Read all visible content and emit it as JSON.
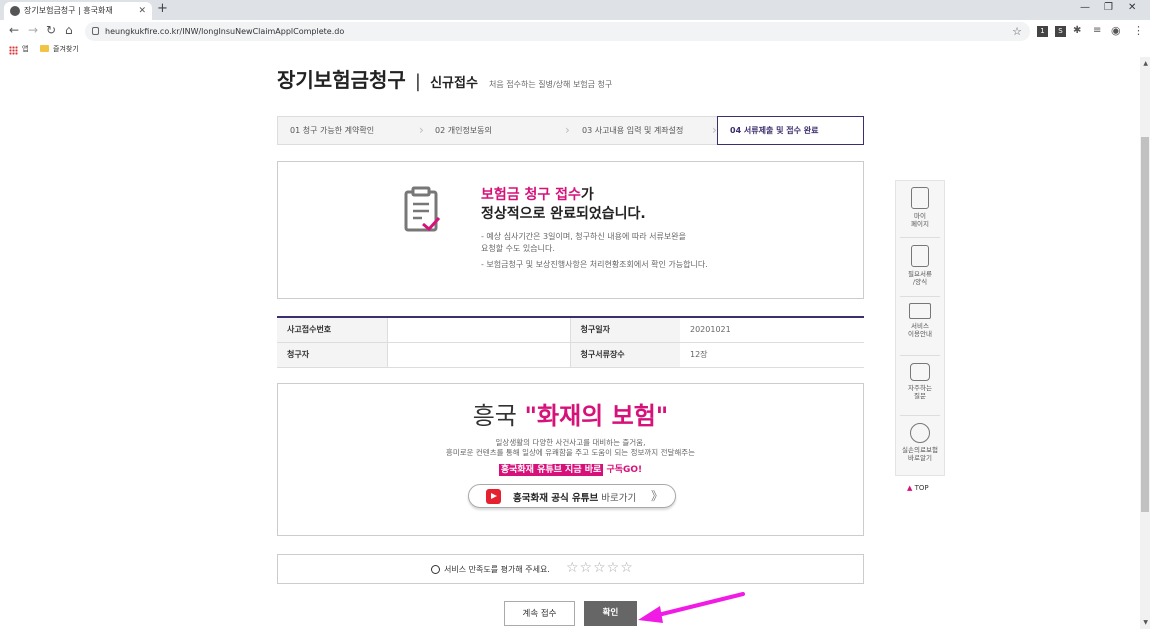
{
  "browser": {
    "tab_title": "장기보험금청구 | 흥국화재",
    "url": "heungkukfire.co.kr/INW/longInsuNewClaimApplComplete.do",
    "bookmarks": [
      "앱",
      "즐겨찾기"
    ],
    "extensions": [
      "1",
      "S"
    ]
  },
  "header": {
    "title": "장기보험금청구",
    "separator": "|",
    "subtitle": "신규접수",
    "description": "처음 접수하는 질병/상해 보험금 청구"
  },
  "steps": [
    {
      "label": "01 청구 가능한 계약확인",
      "active": false
    },
    {
      "label": "02  개인정보동의",
      "active": false
    },
    {
      "label": "03  사고내용 입력 및 계좌설정",
      "active": false
    },
    {
      "label": "04  서류제출 및 접수 완료",
      "active": true
    }
  ],
  "completion": {
    "highlight": "보험금 청구 접수",
    "head_suffix": "가",
    "head_line2": "정상적으로 완료되었습니다.",
    "notes": [
      "-  예상 심사기간은 3일이며, 청구하신 내용에 따라 서류보완을",
      "    요청할 수도 있습니다.",
      "-  보험금청구 및 보상진행사항은 처리현황조회에서 확인 가능합니다."
    ]
  },
  "info_table": {
    "rows": [
      {
        "label1": "사고접수번호",
        "value1": "",
        "label2": "청구일자",
        "value2": "20201021"
      },
      {
        "label1": "청구자",
        "value1": "",
        "label2": "청구서류장수",
        "value2": "12장"
      }
    ]
  },
  "promo": {
    "title_prefix": "흥국 ",
    "title_highlight": "\"화재의 보험\"",
    "line1": "일상생활의 다양한 사건사고를 대비하는 즐거움,",
    "line2": "흥미로운 컨텐츠를 통해 일상에 유쾌함을 주고 도움이 되는 정보까지 전달해주는",
    "cta_highlight": "흥국화재 유튜브 지금 바로",
    "cta_suffix": " 구독GO!",
    "youtube_label": "흥국화재 공식 유튜브",
    "youtube_suffix": " 바로가기",
    "chevron": "》"
  },
  "rating": {
    "label": "서비스 만족도를 평가해 주세요.",
    "stars": "☆☆☆☆☆"
  },
  "buttons": {
    "continue": "계속 접수",
    "confirm": "확인"
  },
  "quickbar": [
    {
      "label1": "마이",
      "label2": "페이지"
    },
    {
      "label1": "필요서류",
      "label2": "/양식"
    },
    {
      "label1": "서비스",
      "label2": "이용안내"
    },
    {
      "label1": "자주하는",
      "label2": "질문"
    },
    {
      "label1": "실손의료보험",
      "label2": "바로알기"
    }
  ],
  "top_link": "TOP",
  "colors": {
    "brand_purple": "#3d2e6e",
    "brand_pink": "#d6127a",
    "annotation_arrow": "#f01ce6"
  }
}
